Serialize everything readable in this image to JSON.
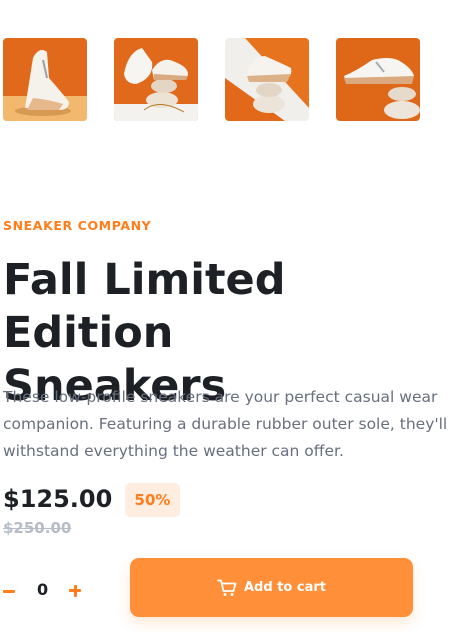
{
  "gallery": {
    "thumbnails": [
      {
        "icon": "sneaker-thumbnail-1"
      },
      {
        "icon": "sneaker-thumbnail-2"
      },
      {
        "icon": "sneaker-thumbnail-3"
      },
      {
        "icon": "sneaker-thumbnail-4"
      }
    ]
  },
  "product": {
    "company": "SNEAKER COMPANY",
    "title_line1": "Fall Limited Edition",
    "title_line2": "Sneakers",
    "description_line1": "These low-profile sneakers are your perfect casual wear",
    "description_line2": "companion. Featuring a durable rubber outer sole, they'll",
    "description_line3": "withstand everything the weather can offer.",
    "price": "$125.00",
    "discount": "50%",
    "original_price": "$250.00"
  },
  "cart": {
    "quantity": "0",
    "add_label": "Add to cart",
    "icon": "cart-icon"
  },
  "colors": {
    "accent": "#ff7d1a",
    "accent_light": "#ffede0",
    "button": "#ff8f38",
    "text_dark": "#1d2025",
    "text_muted": "#68707d",
    "text_strike": "#b6bcc8"
  }
}
